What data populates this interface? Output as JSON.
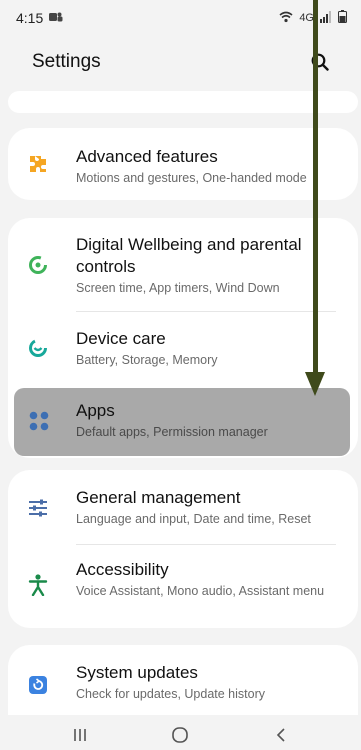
{
  "status": {
    "time": "4:15",
    "network_label": "4G"
  },
  "header": {
    "title": "Settings"
  },
  "items": [
    {
      "title": "Advanced features",
      "subtitle": "Motions and gestures, One-handed mode",
      "icon": "puzzle-icon",
      "color": "#f5a623"
    },
    {
      "title": "Digital Wellbeing and parental controls",
      "subtitle": "Screen time, App timers, Wind Down",
      "icon": "wellbeing-icon",
      "color": "#3fb35a"
    },
    {
      "title": "Device care",
      "subtitle": "Battery, Storage, Memory",
      "icon": "device-care-icon",
      "color": "#17a89a"
    },
    {
      "title": "Apps",
      "subtitle": "Default apps, Permission manager",
      "icon": "apps-grid-icon",
      "color": "#3d6fb3"
    },
    {
      "title": "General management",
      "subtitle": "Language and input, Date and time, Reset",
      "icon": "sliders-icon",
      "color": "#4b6ea8"
    },
    {
      "title": "Accessibility",
      "subtitle": "Voice Assistant, Mono audio, Assistant menu",
      "icon": "accessibility-icon",
      "color": "#1a8a4a"
    },
    {
      "title": "System updates",
      "subtitle": "Check for updates, Update history",
      "icon": "system-update-icon",
      "color": "#3b82e0"
    }
  ],
  "nav": {
    "recents": "recents-icon",
    "home": "home-icon",
    "back": "back-icon"
  }
}
